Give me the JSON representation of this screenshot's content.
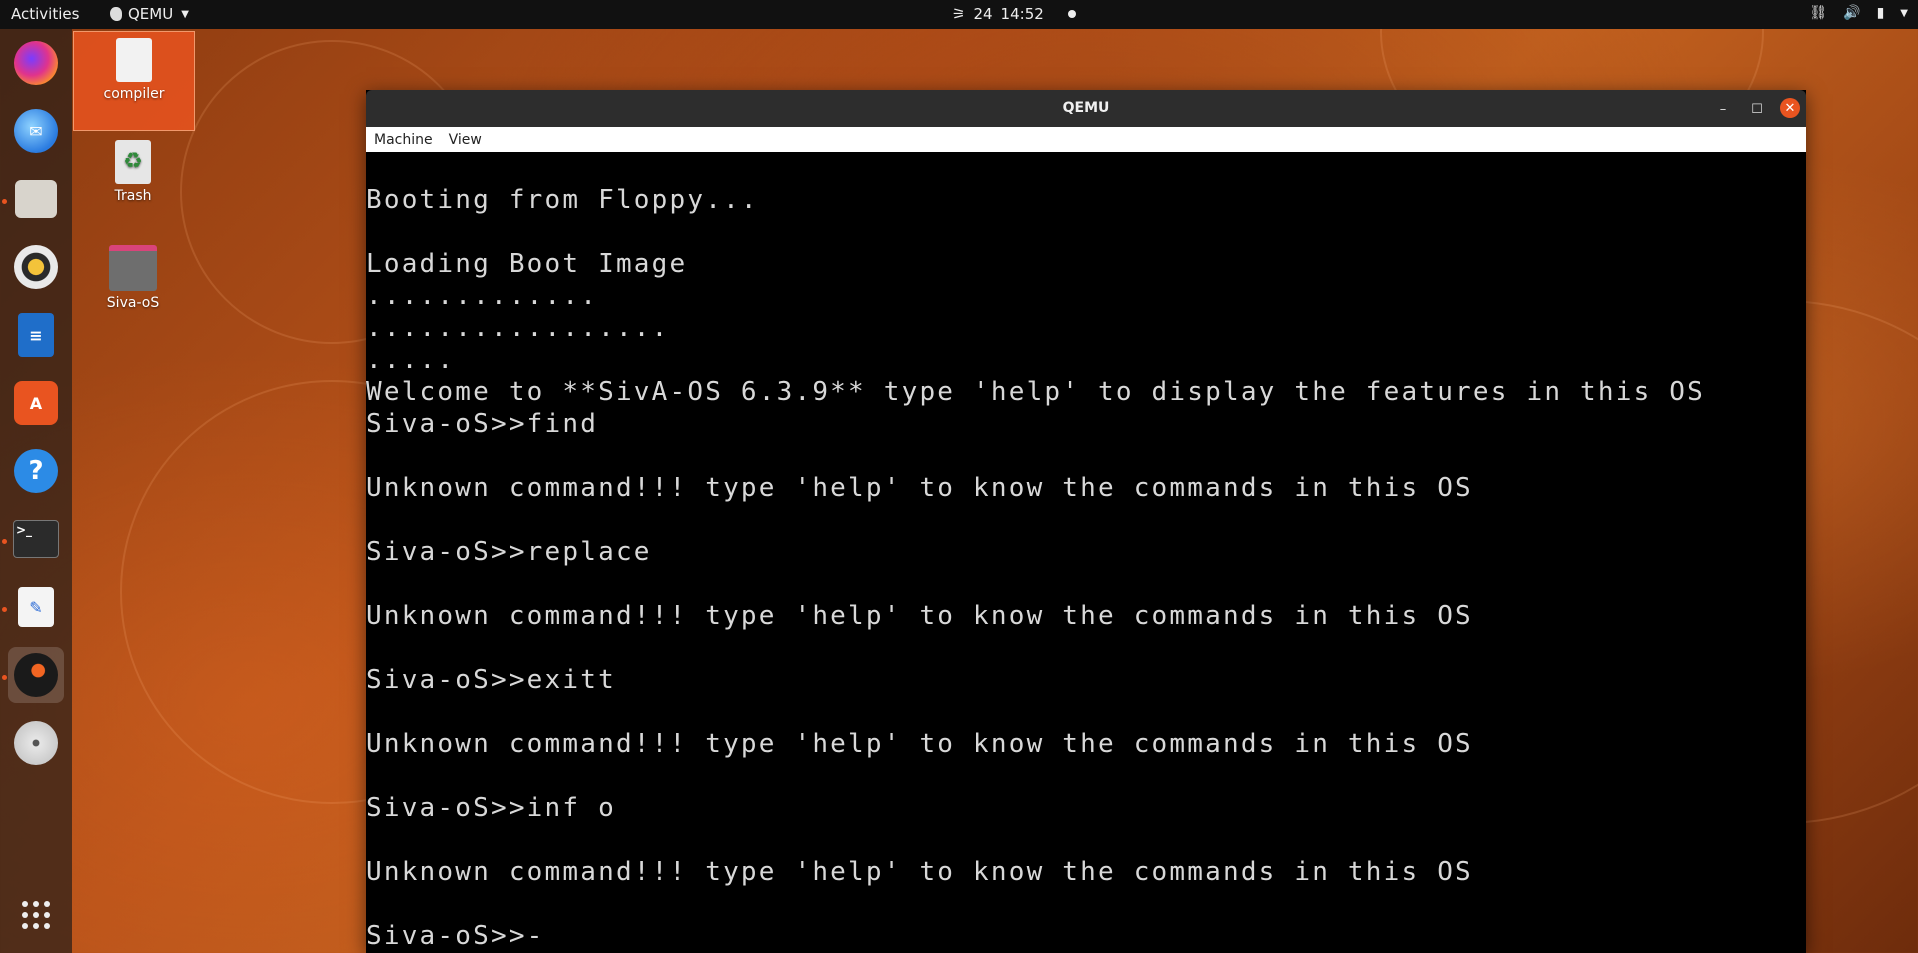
{
  "topbar": {
    "activities": "Activities",
    "app_name": "QEMU",
    "date": "24",
    "time": "14:52"
  },
  "desktop": {
    "icons": [
      {
        "label": "compiler"
      },
      {
        "label": "Trash"
      },
      {
        "label": "Siva-oS"
      }
    ]
  },
  "dock": {
    "items": [
      "Firefox",
      "Thunderbird",
      "Files",
      "Rhythmbox",
      "LibreOffice Writer",
      "Ubuntu Software",
      "Help",
      "Terminal",
      "Text Editor",
      "QEMU",
      "Disc"
    ]
  },
  "window": {
    "title": "QEMU",
    "menu": [
      "Machine",
      "View"
    ],
    "console_lines": [
      "",
      "Booting from Floppy...",
      "",
      "Loading Boot Image",
      ".............",
      ".................",
      ".....",
      "Welcome to **SivA-OS 6.3.9** type 'help' to display the features in this OS",
      "Siva-oS>>find",
      "",
      "Unknown command!!! type 'help' to know the commands in this OS",
      "",
      "Siva-oS>>replace",
      "",
      "Unknown command!!! type 'help' to know the commands in this OS",
      "",
      "Siva-oS>>exitt",
      "",
      "Unknown command!!! type 'help' to know the commands in this OS",
      "",
      "Siva-oS>>inf o",
      "",
      "Unknown command!!! type 'help' to know the commands in this OS",
      "",
      "Siva-oS>>-"
    ]
  }
}
